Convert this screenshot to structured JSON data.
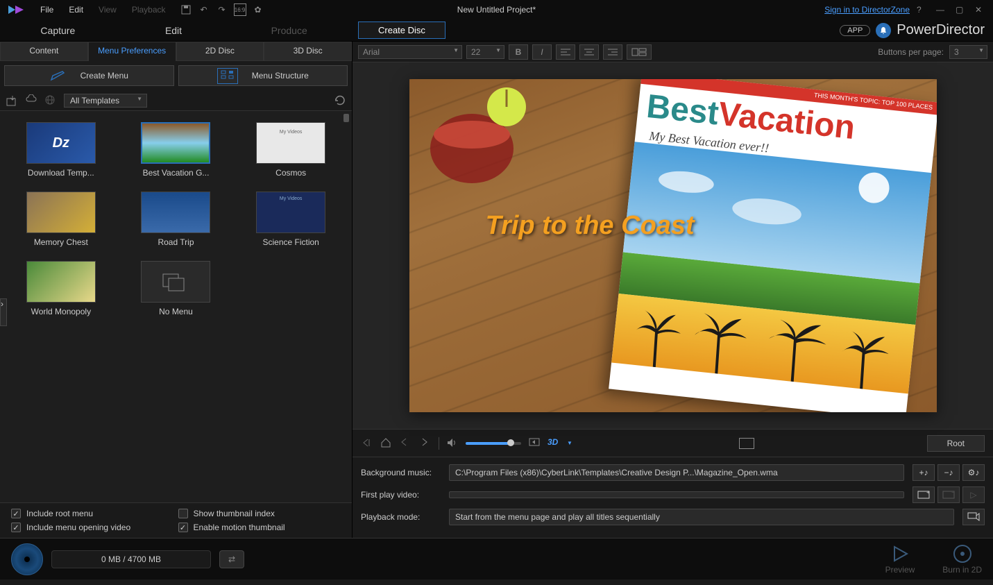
{
  "menubar": {
    "items": [
      "File",
      "Edit",
      "View",
      "Playback"
    ],
    "disabled_idx": [
      2,
      3
    ],
    "title": "New Untitled Project*",
    "signin": "Sign in to DirectorZone"
  },
  "brand": {
    "app_pill": "APP",
    "name": "PowerDirector"
  },
  "mode_tabs": {
    "items": [
      "Capture",
      "Edit",
      "Produce"
    ],
    "disabled_idx": [
      2
    ],
    "create_disc": "Create Disc"
  },
  "sub_tabs": [
    "Content",
    "Menu Preferences",
    "2D Disc",
    "3D Disc"
  ],
  "active_sub_tab": 1,
  "create_menu_btn": "Create Menu",
  "menu_struct_btn": "Menu Structure",
  "filter_dropdown": "All Templates",
  "templates": [
    {
      "label": "Download Temp...",
      "kind": "dz"
    },
    {
      "label": "Best Vacation G...",
      "kind": "vacation",
      "selected": true
    },
    {
      "label": "Cosmos",
      "kind": "cosmos"
    },
    {
      "label": "Memory Chest",
      "kind": "memory"
    },
    {
      "label": "Road Trip",
      "kind": "roadtrip"
    },
    {
      "label": "Science Fiction",
      "kind": "scifi"
    },
    {
      "label": "World Monopoly",
      "kind": "monopoly"
    },
    {
      "label": "No Menu",
      "kind": "nomenu"
    }
  ],
  "checkboxes": {
    "root": {
      "label": "Include root menu",
      "checked": true
    },
    "thumb_index": {
      "label": "Show thumbnail index",
      "checked": false
    },
    "opening_video": {
      "label": "Include menu opening video",
      "checked": true
    },
    "motion_thumb": {
      "label": "Enable motion thumbnail",
      "checked": true
    }
  },
  "text_toolbar": {
    "font": "Arial",
    "size": "22",
    "buttons_per_page_label": "Buttons per page:",
    "buttons_per_page": "3"
  },
  "preview": {
    "overlay_text": "Trip to the Coast",
    "mag_topstrip": "THIS MONTH'S TOPIC: TOP 100 PLACES",
    "mag_title_1": "Best",
    "mag_title_2": "Vacation",
    "mag_subtitle": "My Best Vacation ever!!"
  },
  "playback": {
    "root_btn": "Root",
    "threed": "3D"
  },
  "settings": {
    "bg_music_label": "Background music:",
    "bg_music_value": "C:\\Program Files (x86)\\CyberLink\\Templates\\Creative Design P...\\Magazine_Open.wma",
    "first_play_label": "First play video:",
    "first_play_value": "",
    "playback_mode_label": "Playback mode:",
    "playback_mode_value": "Start from the menu page and play all titles sequentially"
  },
  "bottom": {
    "progress": "0 MB / 4700 MB",
    "preview": "Preview",
    "burn": "Burn in 2D"
  }
}
